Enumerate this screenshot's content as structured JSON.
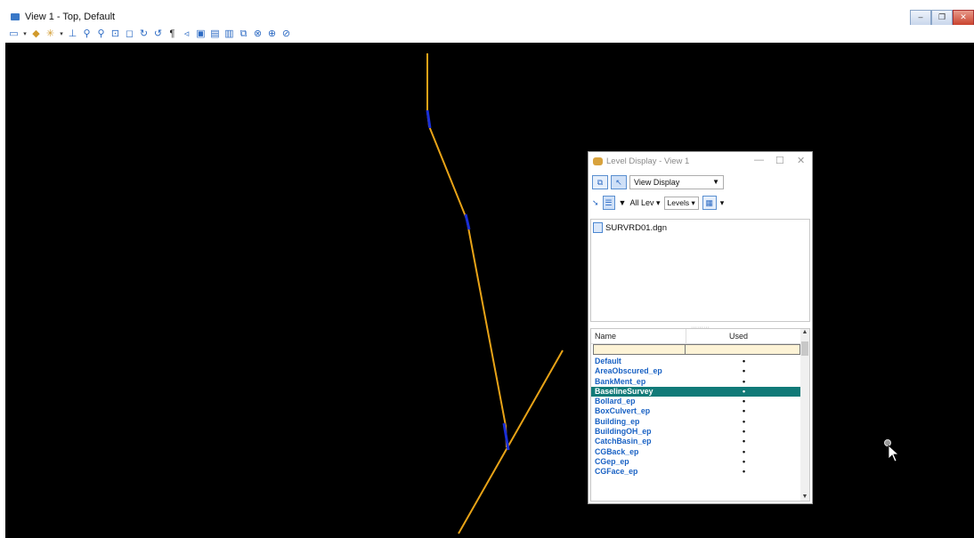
{
  "window": {
    "title": "View 1 - Top, Default",
    "controls": [
      "minimize",
      "restore",
      "close"
    ]
  },
  "toolbar": {
    "icons": [
      "view-attributes-icon",
      "view-dropdown-icon",
      "render-icon",
      "light-icon",
      "dropdown-icon",
      "update-icon",
      "zoom-in-icon",
      "zoom-out-icon",
      "window-area-icon",
      "fit-view-icon",
      "rotate-icon",
      "pan-icon",
      "walk-icon",
      "view-previous-icon",
      "view-next-icon",
      "copy-view-icon",
      "clip-volume-icon",
      "clip-mask-icon",
      "camera-icon",
      "levels-icon"
    ]
  },
  "level_display": {
    "title": "Level Display - View 1",
    "view_mode": "View Display",
    "filter_label": "All Lev",
    "levels_menu": "Levels",
    "file": "SURVRD01.dgn",
    "columns": {
      "name": "Name",
      "used": "Used"
    },
    "rows": [
      {
        "name": "Default",
        "used": "•"
      },
      {
        "name": "AreaObscured_ep",
        "used": "•"
      },
      {
        "name": "BankMent_ep",
        "used": "•"
      },
      {
        "name": "BaselineSurvey",
        "used": "•",
        "selected": true
      },
      {
        "name": "Bollard_ep",
        "used": "•"
      },
      {
        "name": "BoxCulvert_ep",
        "used": "•"
      },
      {
        "name": "Building_ep",
        "used": "•"
      },
      {
        "name": "BuildingOH_ep",
        "used": "•"
      },
      {
        "name": "CatchBasin_ep",
        "used": "•"
      },
      {
        "name": "CGBack_ep",
        "used": "•"
      },
      {
        "name": "CGep_ep",
        "used": "•"
      },
      {
        "name": "CGFace_ep",
        "used": "•"
      }
    ]
  },
  "colors": {
    "canvas": "#000000",
    "line": "#e8a317",
    "vertex": "#1a2fd6",
    "selected_row": "#117a78",
    "level_text": "#1a62c4"
  }
}
